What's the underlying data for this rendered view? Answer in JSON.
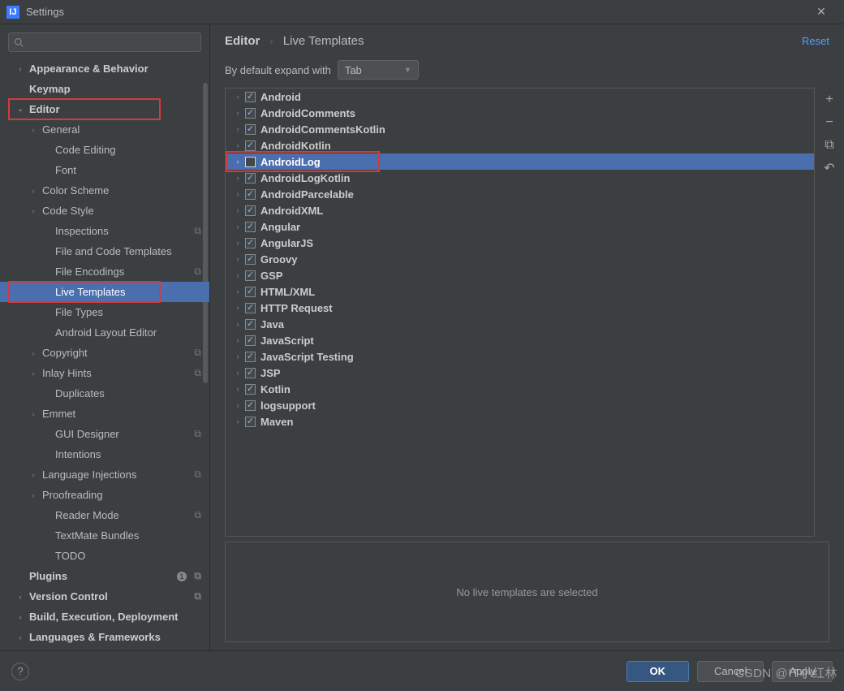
{
  "window": {
    "title": "Settings"
  },
  "search": {
    "placeholder": ""
  },
  "header": {
    "reset": "Reset"
  },
  "breadcrumb": {
    "root": "Editor",
    "leaf": "Live Templates"
  },
  "expand": {
    "label": "By default expand with",
    "value": "Tab"
  },
  "status": {
    "empty": "No live templates are selected"
  },
  "footer": {
    "ok": "OK",
    "cancel": "Cancel",
    "apply": "Apply"
  },
  "watermark": "CSDN @IT小红林",
  "sidebar": [
    {
      "label": "Appearance & Behavior",
      "indent": 0,
      "expand": "›",
      "bold": true
    },
    {
      "label": "Keymap",
      "indent": 0,
      "expand": "",
      "bold": true
    },
    {
      "label": "Editor",
      "indent": 0,
      "expand": "⌄",
      "bold": true,
      "redbox": true
    },
    {
      "label": "General",
      "indent": 1,
      "expand": "›"
    },
    {
      "label": "Code Editing",
      "indent": 2,
      "expand": ""
    },
    {
      "label": "Font",
      "indent": 2,
      "expand": ""
    },
    {
      "label": "Color Scheme",
      "indent": 1,
      "expand": "›"
    },
    {
      "label": "Code Style",
      "indent": 1,
      "expand": "›"
    },
    {
      "label": "Inspections",
      "indent": 2,
      "expand": "",
      "badge": "⧉"
    },
    {
      "label": "File and Code Templates",
      "indent": 2,
      "expand": ""
    },
    {
      "label": "File Encodings",
      "indent": 2,
      "expand": "",
      "badge": "⧉"
    },
    {
      "label": "Live Templates",
      "indent": 2,
      "expand": "",
      "selected": true,
      "redbox": true
    },
    {
      "label": "File Types",
      "indent": 2,
      "expand": ""
    },
    {
      "label": "Android Layout Editor",
      "indent": 2,
      "expand": ""
    },
    {
      "label": "Copyright",
      "indent": 1,
      "expand": "›",
      "badge": "⧉"
    },
    {
      "label": "Inlay Hints",
      "indent": 1,
      "expand": "›",
      "badge": "⧉"
    },
    {
      "label": "Duplicates",
      "indent": 2,
      "expand": ""
    },
    {
      "label": "Emmet",
      "indent": 1,
      "expand": "›"
    },
    {
      "label": "GUI Designer",
      "indent": 2,
      "expand": "",
      "badge": "⧉"
    },
    {
      "label": "Intentions",
      "indent": 2,
      "expand": ""
    },
    {
      "label": "Language Injections",
      "indent": 1,
      "expand": "›",
      "badge": "⧉"
    },
    {
      "label": "Proofreading",
      "indent": 1,
      "expand": "›"
    },
    {
      "label": "Reader Mode",
      "indent": 2,
      "expand": "",
      "badge": "⧉"
    },
    {
      "label": "TextMate Bundles",
      "indent": 2,
      "expand": ""
    },
    {
      "label": "TODO",
      "indent": 2,
      "expand": ""
    },
    {
      "label": "Plugins",
      "indent": 0,
      "expand": "",
      "bold": true,
      "badge": "⧉",
      "dot": "1"
    },
    {
      "label": "Version Control",
      "indent": 0,
      "expand": "›",
      "bold": true,
      "badge": "⧉"
    },
    {
      "label": "Build, Execution, Deployment",
      "indent": 0,
      "expand": "›",
      "bold": true
    },
    {
      "label": "Languages & Frameworks",
      "indent": 0,
      "expand": "›",
      "bold": true
    }
  ],
  "templates": [
    {
      "label": "Android",
      "checked": true,
      "bold": true
    },
    {
      "label": "AndroidComments",
      "checked": true,
      "bold": true
    },
    {
      "label": "AndroidCommentsKotlin",
      "checked": true,
      "bold": true
    },
    {
      "label": "AndroidKotlin",
      "checked": true,
      "bold": true
    },
    {
      "label": "AndroidLog",
      "checked": false,
      "bold": true,
      "selected": true,
      "redbox": true
    },
    {
      "label": "AndroidLogKotlin",
      "checked": true,
      "bold": true
    },
    {
      "label": "AndroidParcelable",
      "checked": true,
      "bold": true
    },
    {
      "label": "AndroidXML",
      "checked": true,
      "bold": true
    },
    {
      "label": "Angular",
      "checked": true,
      "bold": true
    },
    {
      "label": "AngularJS",
      "checked": true,
      "bold": true
    },
    {
      "label": "Groovy",
      "checked": true,
      "bold": true
    },
    {
      "label": "GSP",
      "checked": true,
      "bold": true
    },
    {
      "label": "HTML/XML",
      "checked": true,
      "bold": true
    },
    {
      "label": "HTTP Request",
      "checked": true,
      "bold": true
    },
    {
      "label": "Java",
      "checked": true,
      "bold": true
    },
    {
      "label": "JavaScript",
      "checked": true,
      "bold": true
    },
    {
      "label": "JavaScript Testing",
      "checked": true,
      "bold": true
    },
    {
      "label": "JSP",
      "checked": true,
      "bold": true
    },
    {
      "label": "Kotlin",
      "checked": true,
      "bold": true
    },
    {
      "label": "logsupport",
      "checked": true,
      "bold": true
    },
    {
      "label": "Maven",
      "checked": true,
      "bold": true
    }
  ],
  "sideactions": {
    "add": "+",
    "remove": "−",
    "copy": "⧉",
    "undo": "↶"
  }
}
